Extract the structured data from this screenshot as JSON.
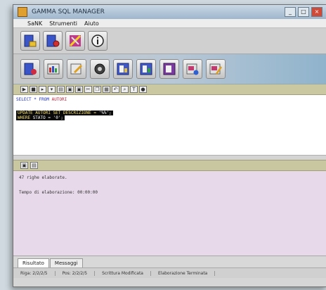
{
  "window": {
    "title": "GAMMA SQL MANAGER",
    "controls": {
      "minimize": "_",
      "maximize": "□",
      "close": "×"
    }
  },
  "menu": {
    "items": [
      {
        "label": "SaNK"
      },
      {
        "label": "Strumenti"
      },
      {
        "label": "Aiuto"
      }
    ]
  },
  "toolbar_main": {
    "buttons": [
      {
        "name": "new-db-button",
        "icon": "database-new-icon"
      },
      {
        "name": "open-db-button",
        "icon": "database-open-icon"
      },
      {
        "name": "tools-button",
        "icon": "tools-icon"
      },
      {
        "name": "info-button",
        "icon": "info-icon",
        "glyph": "i"
      }
    ]
  },
  "toolbar_objects": {
    "buttons": [
      {
        "name": "delete-db-button",
        "icon": "database-delete-icon"
      },
      {
        "name": "tables-button",
        "icon": "table-icon"
      },
      {
        "name": "edit-button",
        "icon": "pencil-icon"
      },
      {
        "name": "query-button",
        "icon": "gear-icon"
      },
      {
        "name": "form-1-button",
        "icon": "form-icon"
      },
      {
        "name": "form-2-button",
        "icon": "form-icon"
      },
      {
        "name": "report-button",
        "icon": "report-icon"
      },
      {
        "name": "export-button",
        "icon": "export-icon"
      },
      {
        "name": "settings-button",
        "icon": "settings-icon"
      }
    ]
  },
  "editor": {
    "line1_kw": "SELECT * FROM ",
    "line1_tbl": "AUTORI",
    "line2_a": "UPDATE AUTORI SET ",
    "line2_b": "DESCRIZIONE = ",
    "line2_c": "'%%';",
    "line3_a": "WHERE ",
    "line3_b": "STATO = '0';"
  },
  "results": {
    "line1": "47 righe elaborate.",
    "line2": "Tempo di elaborazione: 00:00:00"
  },
  "tabs": [
    {
      "label": "Risultato",
      "active": true
    },
    {
      "label": "Messaggi",
      "active": false
    }
  ],
  "status": {
    "row": "Riga: 2/2/2/5",
    "col": "Pos: 2/2/2/5",
    "mode": "Scrittura Modificata",
    "state": "Elaborazione Terminata"
  },
  "colors": {
    "editor_bg": "#ffffff",
    "results_bg": "#e7d9ea",
    "sql_toolbar": "#c9c8a0",
    "selection_bg": "#0a0a0a",
    "selection_text": "#f5e070"
  }
}
